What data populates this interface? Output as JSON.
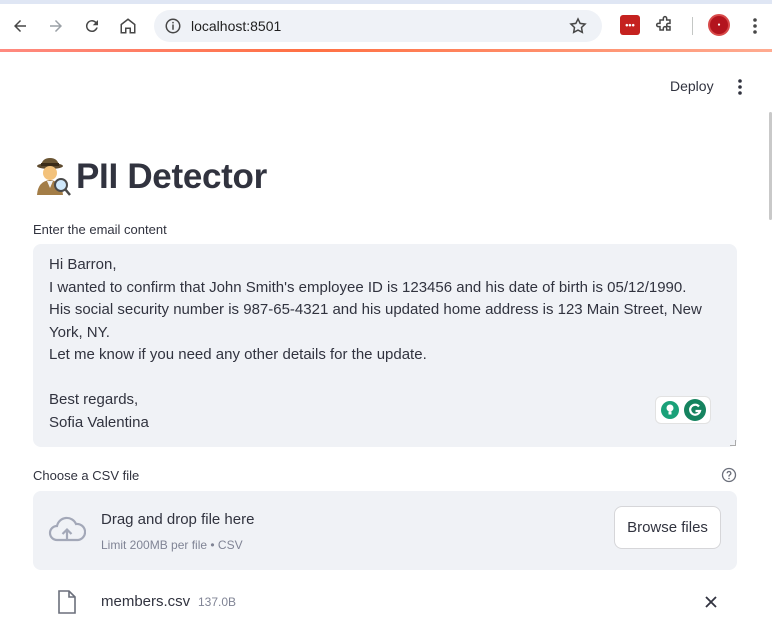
{
  "browser": {
    "url": "localhost:8501"
  },
  "header": {
    "deploy_label": "Deploy"
  },
  "main": {
    "title": "PII Detector",
    "title_emoji": "detective",
    "email_label": "Enter the email content",
    "email_lines": [
      "Hi Barron,",
      "I wanted to confirm that John Smith's employee ID is 123456 and his date of birth is 05/12/1990.",
      "His social security number is 987-65-4321 and his updated home address is 123 Main Street, New",
      "York, NY.",
      "Let me know if you need any other details for the update.",
      "",
      "Best regards,",
      "Sofia Valentina"
    ],
    "csv_label": "Choose a CSV file",
    "dropzone": {
      "title": "Drag and drop file here",
      "limit": "Limit 200MB per file • CSV",
      "browse_label": "Browse files"
    },
    "uploaded_file": {
      "name": "members.csv",
      "size": "137.0B"
    }
  },
  "icons": [
    "back-arrow-icon",
    "forward-arrow-icon",
    "reload-icon",
    "home-icon",
    "site-info-icon",
    "bookmark-star-icon",
    "extensions-icon",
    "kebab-menu-icon",
    "help-icon",
    "cloud-upload-icon",
    "file-icon",
    "close-icon"
  ],
  "colors": {
    "accent": "#ff4b4b",
    "input_bg": "#f0f2f6",
    "text": "#31333f",
    "muted": "#808495"
  }
}
